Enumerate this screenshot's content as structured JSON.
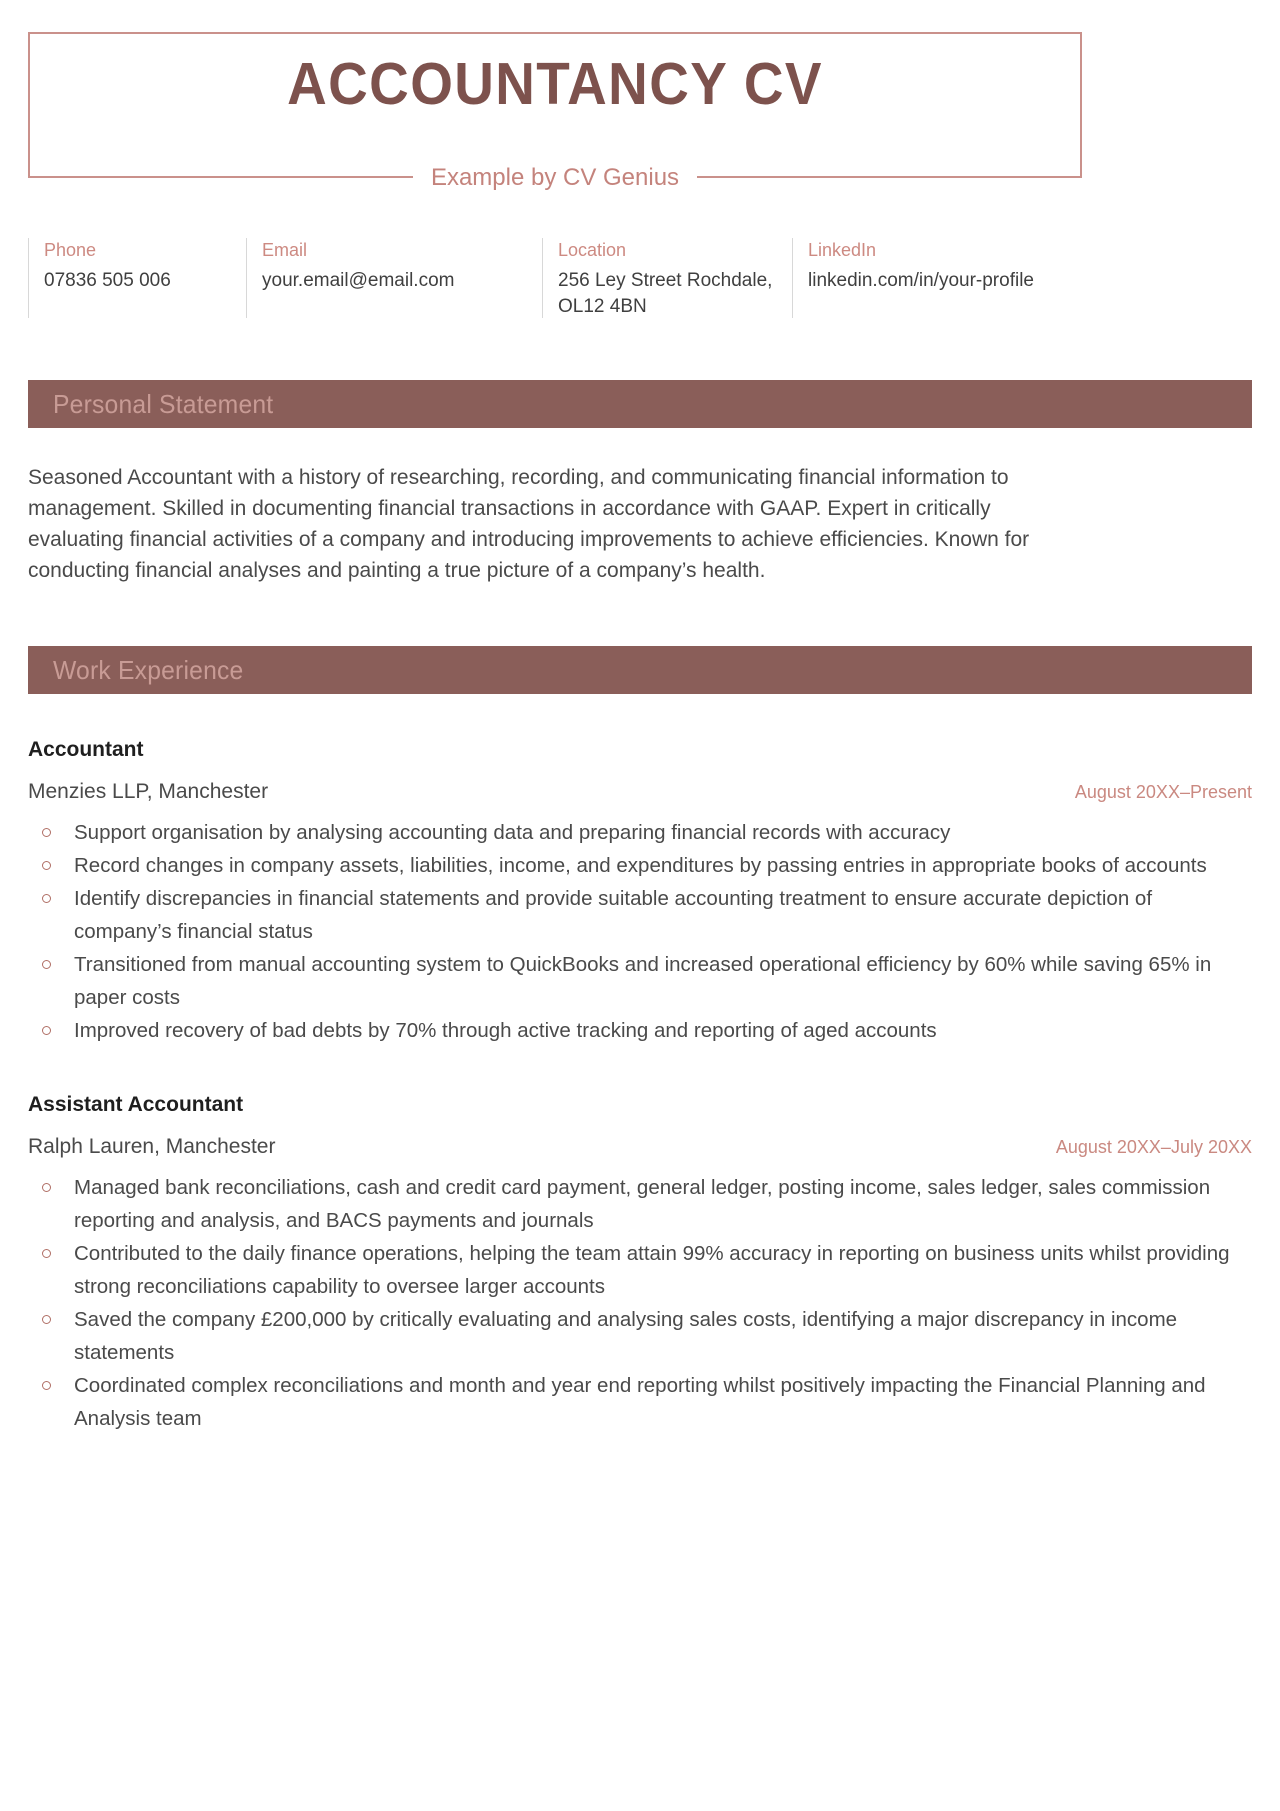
{
  "header": {
    "title": "ACCOUNTANCY CV",
    "subtitle": "Example by CV Genius"
  },
  "contact": {
    "items": [
      {
        "label": "Phone",
        "value": "07836 505 006"
      },
      {
        "label": "Email",
        "value": "your.email@email.com"
      },
      {
        "label": "Location",
        "value": "256 Ley Street Rochdale, OL12 4BN"
      },
      {
        "label": "LinkedIn",
        "value": "linkedin.com/in/your-profile"
      }
    ]
  },
  "sections": {
    "personal_statement": {
      "heading": "Personal Statement",
      "body": "Seasoned Accountant with a history of researching, recording, and communicating financial information to management. Skilled in documenting financial transactions in accordance with GAAP. Expert in critically evaluating financial activities of a company and introducing improvements to achieve efficiencies. Known for conducting financial analyses and painting a true picture of a company’s health."
    },
    "work_experience": {
      "heading": "Work Experience",
      "jobs": [
        {
          "title": "Accountant",
          "company": "Menzies LLP, Manchester",
          "dates": "August 20XX–Present",
          "bullets": [
            "Support organisation by analysing accounting data and preparing financial records with accuracy",
            "Record changes in company assets, liabilities, income, and expenditures by passing entries in appropriate books of accounts",
            "Identify discrepancies in financial statements and provide suitable accounting treatment to ensure accurate depiction of company’s financial status",
            "Transitioned from manual accounting system to QuickBooks and increased operational efficiency by 60% while saving 65% in paper costs",
            "Improved recovery of bad debts by 70% through active tracking and reporting of aged accounts"
          ]
        },
        {
          "title": "Assistant Accountant",
          "company": "Ralph Lauren, Manchester",
          "dates": "August 20XX–July 20XX",
          "bullets": [
            "Managed bank reconciliations, cash and credit card payment, general ledger, posting income, sales ledger, sales commission reporting and analysis, and BACS payments and journals",
            "Contributed to the daily finance operations, helping the team attain 99% accuracy in reporting on business units whilst providing strong reconciliations capability to oversee larger accounts",
            "Saved the company £200,000 by critically evaluating and analysing sales costs, identifying a major discrepancy in income statements",
            "Coordinated complex reconciliations and month and year end reporting whilst positively impacting the Financial Planning and Analysis team"
          ]
        }
      ]
    }
  },
  "theme": {
    "accent_border": "#ca918b",
    "title_color": "#7d524d",
    "subtitle_color": "#c4837c",
    "section_bar_bg": "#8a5e59",
    "section_bar_text": "#c89b95",
    "label_color": "#cd8a82",
    "body_color": "#4a4a4a",
    "bullet_color": "#b06f66"
  }
}
